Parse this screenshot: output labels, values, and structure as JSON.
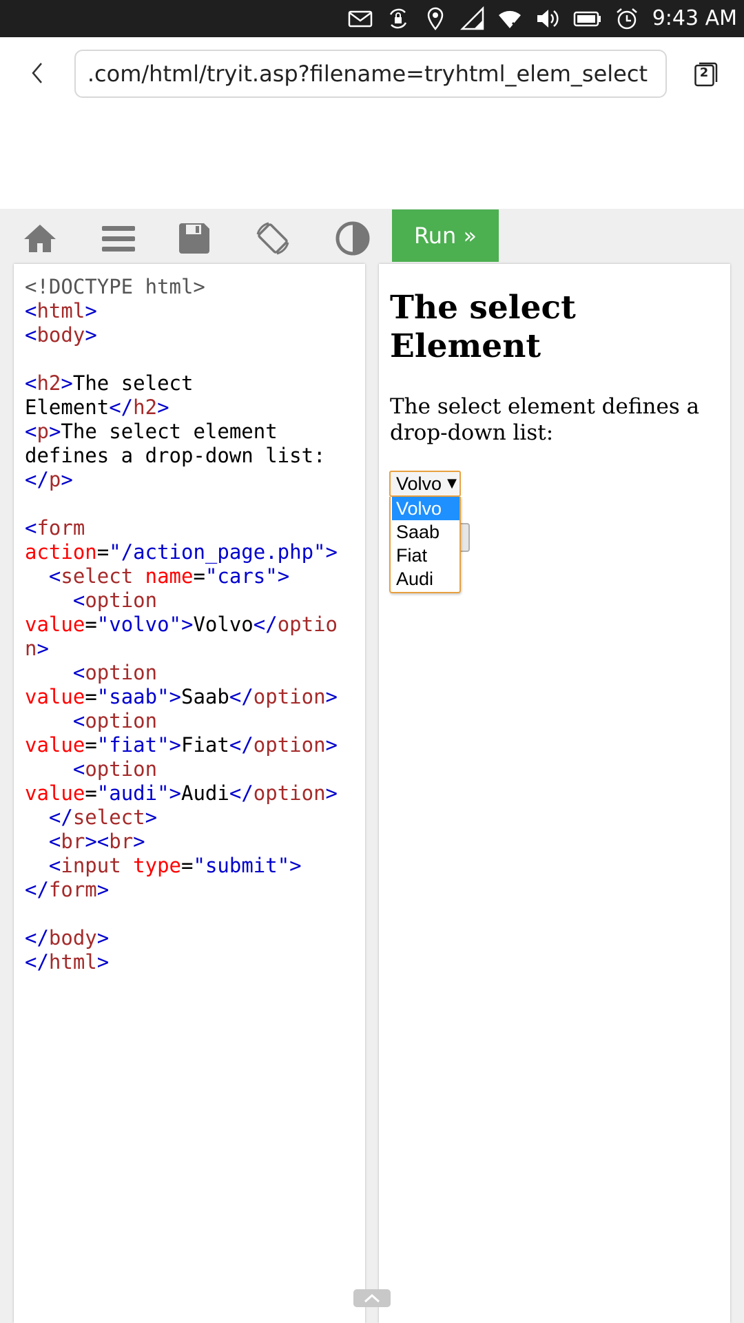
{
  "status_bar": {
    "time": "9:43 AM",
    "icons": [
      "mail-icon",
      "rotation-lock-icon",
      "location-icon",
      "cell-signal-icon",
      "wifi-icon",
      "volume-icon",
      "battery-icon",
      "alarm-icon"
    ]
  },
  "browser": {
    "url": ".com/html/tryit.asp?filename=tryhtml_elem_select",
    "tab_count": "2"
  },
  "tryit": {
    "run_label": "Run »",
    "toolbar_icons": [
      "home-icon",
      "menu-icon",
      "save-icon",
      "rotate-icon",
      "contrast-icon"
    ]
  },
  "code": {
    "doctype": "<!DOCTYPE html>",
    "html_open": "html",
    "body_open": "body",
    "h2_tag": "h2",
    "h2_text_1": "The select",
    "h2_text_2": "Element",
    "p_tag": "p",
    "p_text_1": "The select element",
    "p_text_2": "defines a drop-down list:",
    "form_tag": "form",
    "action_attr": "action",
    "action_val": "\"/action_page.php\"",
    "select_tag": "select",
    "name_attr": "name",
    "name_val": "\"cars\"",
    "option_tag": "option",
    "option_tag_a": "optio",
    "option_tag_b": "n",
    "value_attr": "value",
    "options": [
      {
        "value": "\"volvo\"",
        "text": "Volvo"
      },
      {
        "value": "\"saab\"",
        "text": "Saab"
      },
      {
        "value": "\"fiat\"",
        "text": "Fiat"
      },
      {
        "value": "\"audi\"",
        "text": "Audi"
      }
    ],
    "br_tag": "br",
    "input_tag": "input",
    "type_attr": "type",
    "type_val": "\"submit\""
  },
  "result": {
    "heading": "The select Element",
    "paragraph": "The select element defines a drop-down list:",
    "select_value": "Volvo",
    "options": [
      "Volvo",
      "Saab",
      "Fiat",
      "Audi"
    ]
  }
}
